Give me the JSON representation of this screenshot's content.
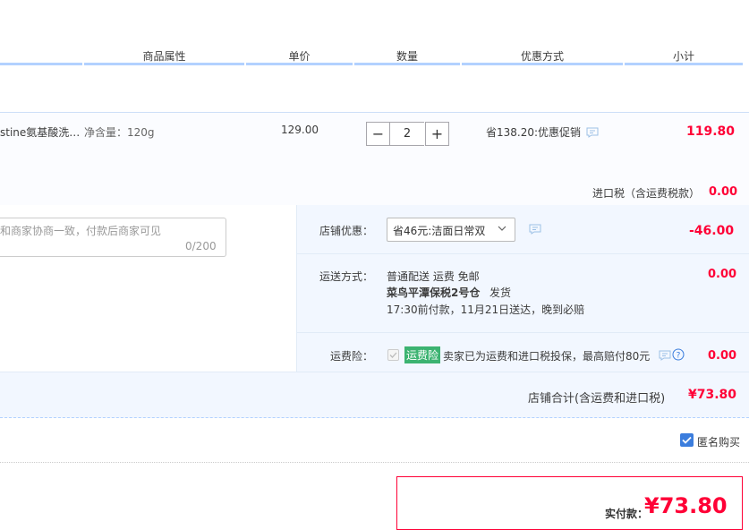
{
  "header": {
    "attr": "商品属性",
    "price": "单价",
    "qty": "数量",
    "discount": "优惠方式",
    "subtotal": "小计"
  },
  "item": {
    "name": "stine氨基酸洗…",
    "attr": "净含量：120g",
    "price": "129.00",
    "qty": "2",
    "minus": "−",
    "plus": "+",
    "promo": "省138.20:优惠促销",
    "subtotal": "119.80"
  },
  "import_tax": {
    "label": "进口税（含运费税款）",
    "value": "0.00"
  },
  "message": {
    "placeholder": "和商家协商一致，付款后商家可见",
    "counter": "0/200"
  },
  "shop_discount": {
    "label": "店铺优惠：",
    "selected": "省46元:洁面日常双",
    "value": "-46.00"
  },
  "shipping": {
    "label": "运送方式：",
    "line1": "普通配送 运费 免邮",
    "line2_bold": "菜鸟平潭保税2号仓",
    "line2_rest": "发货",
    "line3": "17:30前付款，11月21日送达，晚到必赔",
    "value": "0.00"
  },
  "insurance": {
    "label": "运费险：",
    "badge": "运费险",
    "text": "卖家已为运费和进口税投保，最高赔付80元",
    "value": "0.00"
  },
  "shop_total": {
    "label": "店铺合计(含运费和进口税)",
    "value": "¥73.80"
  },
  "anonymous": {
    "label": "匿名购买",
    "checked": true
  },
  "payment": {
    "label": "实付款：",
    "value": "¥73.80"
  },
  "colors": {
    "accent_red": "#ff0036",
    "header_bar": "#b2d1ff",
    "badge_green": "#3cb371",
    "checkbox_blue": "#3b7ddd"
  }
}
